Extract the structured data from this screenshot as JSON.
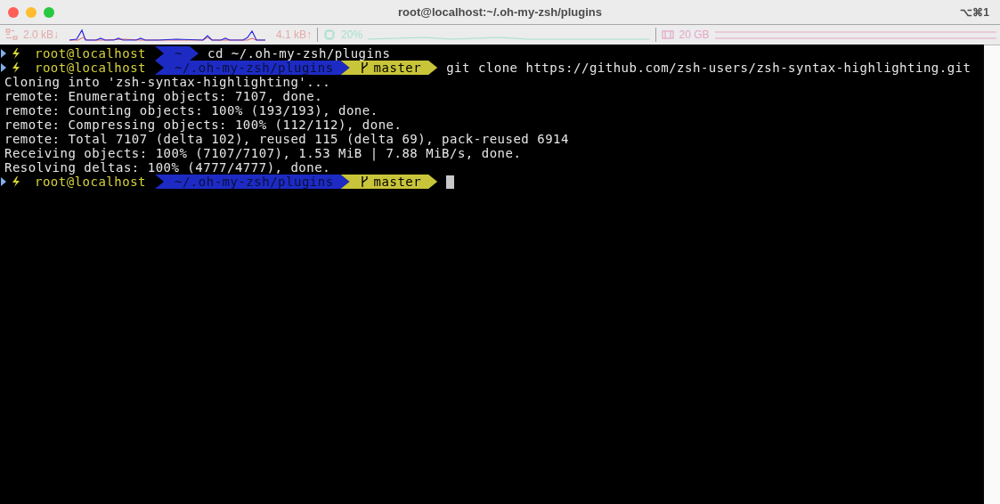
{
  "window": {
    "title": "root@localhost:~/.oh-my-zsh/plugins",
    "shortcut": "⌥⌘1"
  },
  "status_bar": {
    "network_down": "2.0 kB↓",
    "network_up": "4.1 kB↑",
    "cpu": "20%",
    "memory": "20 GB"
  },
  "terminal": {
    "lines": [
      {
        "kind": "prompt",
        "user": "root@localhost",
        "path": "~",
        "command": "cd ~/.oh-my-zsh/plugins"
      },
      {
        "kind": "prompt",
        "user": "root@localhost",
        "path": "~/.oh-my-zsh/plugins",
        "branch": "master",
        "command": "git clone https://github.com/zsh-users/zsh-syntax-highlighting.git"
      },
      {
        "kind": "output",
        "text": "Cloning into 'zsh-syntax-highlighting'..."
      },
      {
        "kind": "output",
        "text": "remote: Enumerating objects: 7107, done."
      },
      {
        "kind": "output",
        "text": "remote: Counting objects: 100% (193/193), done."
      },
      {
        "kind": "output",
        "text": "remote: Compressing objects: 100% (112/112), done."
      },
      {
        "kind": "output",
        "text": "remote: Total 7107 (delta 102), reused 115 (delta 69), pack-reused 6914"
      },
      {
        "kind": "output",
        "text": "Receiving objects: 100% (7107/7107), 1.53 MiB | 7.88 MiB/s, done."
      },
      {
        "kind": "output",
        "text": "Resolving deltas: 100% (4777/4777), done."
      },
      {
        "kind": "prompt",
        "user": "root@localhost",
        "path": "~/.oh-my-zsh/plugins",
        "branch": "master",
        "cursor": true
      }
    ]
  }
}
